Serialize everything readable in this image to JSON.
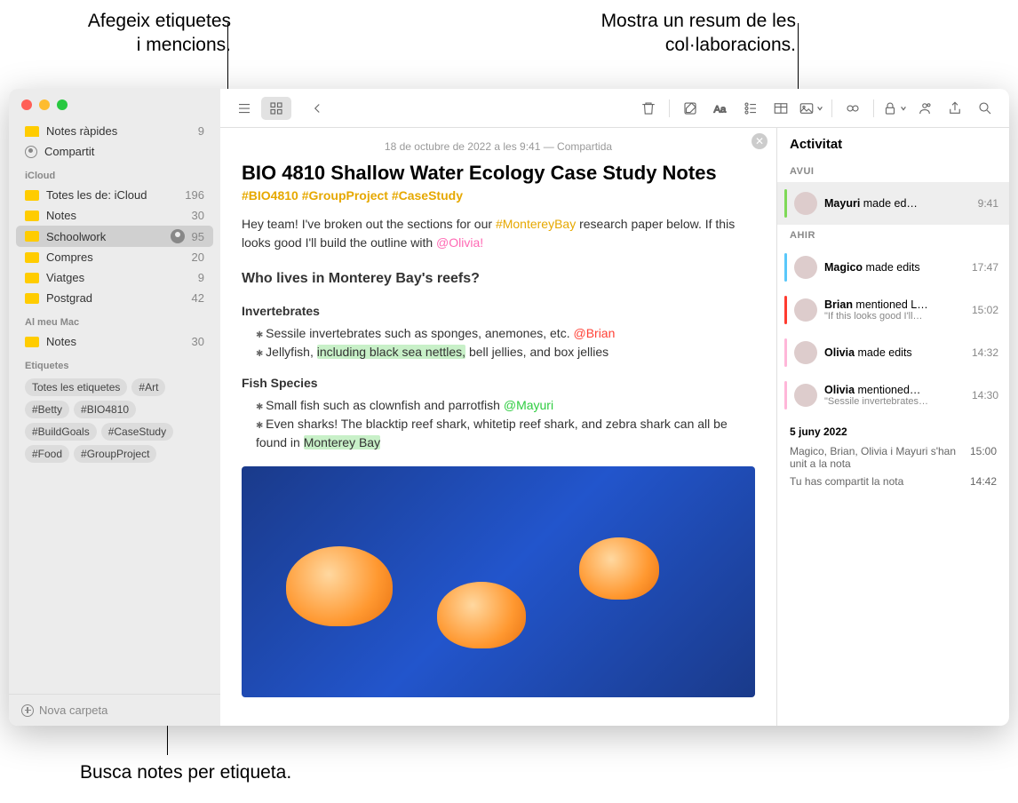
{
  "annotations": {
    "top_left": "Afegeix etiquetes\ni mencions.",
    "top_right": "Mostra un resum de les\ncol·laboracions.",
    "bottom": "Busca notes per etiqueta."
  },
  "sidebar": {
    "quick_label": "Notes ràpides",
    "quick_count": "9",
    "shared_label": "Compartit",
    "icloud_heading": "iCloud",
    "folders_icloud": [
      {
        "label": "Totes les de: iCloud",
        "count": "196"
      },
      {
        "label": "Notes",
        "count": "30"
      },
      {
        "label": "Schoolwork",
        "count": "95",
        "shared": true,
        "selected": true
      },
      {
        "label": "Compres",
        "count": "20"
      },
      {
        "label": "Viatges",
        "count": "9"
      },
      {
        "label": "Postgrad",
        "count": "42"
      }
    ],
    "mac_heading": "Al meu Mac",
    "folders_mac": [
      {
        "label": "Notes",
        "count": "30"
      }
    ],
    "tags_heading": "Etiquetes",
    "tags": [
      "Totes les etiquetes",
      "#Art",
      "#Betty",
      "#BIO4810",
      "#BuildGoals",
      "#CaseStudy",
      "#Food",
      "#GroupProject"
    ],
    "new_folder": "Nova carpeta"
  },
  "note": {
    "meta": "18 de octubre de 2022 a les 9:41 — Compartida",
    "title": "BIO 4810 Shallow Water Ecology Case Study Notes",
    "hashtags": "#BIO4810 #GroupProject #CaseStudy",
    "intro_1": "Hey team! I've broken out the sections for our ",
    "intro_tag": "#MontereyBay",
    "intro_2": " research paper below. If this looks good I'll build the outline with ",
    "intro_mention": "@Olivia!",
    "q_heading": "Who lives in Monterey Bay's reefs?",
    "invert_h": "Invertebrates",
    "invert_1a": "Sessile invertebrates such as sponges, anemones, etc. ",
    "invert_1b": "@Brian",
    "invert_2a": "Jellyfish, ",
    "invert_2b": "including black sea nettles,",
    "invert_2c": " bell jellies, and box jellies",
    "fish_h": "Fish Species",
    "fish_1a": "Small fish such as clownfish and parrotfish ",
    "fish_1b": "@Mayuri",
    "fish_2a": "Even sharks! The blacktip reef shark, whitetip reef shark, and zebra shark can all be found in ",
    "fish_2b": "Monterey Bay"
  },
  "activity": {
    "title": "Activitat",
    "today": "AVUI",
    "yesterday": "AHIR",
    "items_today": [
      {
        "who": "Mayuri",
        "action": " made ed…",
        "time": "9:41",
        "color": "#7ed957",
        "selected": true
      }
    ],
    "items_yesterday": [
      {
        "who": "Magico",
        "action": " made edits",
        "time": "17:47",
        "color": "#5ac8fa"
      },
      {
        "who": "Brian",
        "action": " mentioned L…",
        "sub": "\"If this looks good I'll…",
        "time": "15:02",
        "color": "#ff3b30"
      },
      {
        "who": "Olivia",
        "action": " made edits",
        "time": "14:32",
        "color": "#ffb6d9"
      },
      {
        "who": "Olivia",
        "action": " mentioned…",
        "sub": "\"Sessile invertebrates…",
        "time": "14:30",
        "color": "#ffb6d9"
      }
    ],
    "older_date": "5 juny 2022",
    "older": [
      {
        "text": "Magico, Brian, Olivia i Mayuri s'han unit a la nota",
        "time": "15:00"
      },
      {
        "text": "Tu has compartit la nota",
        "time": "14:42"
      }
    ]
  }
}
